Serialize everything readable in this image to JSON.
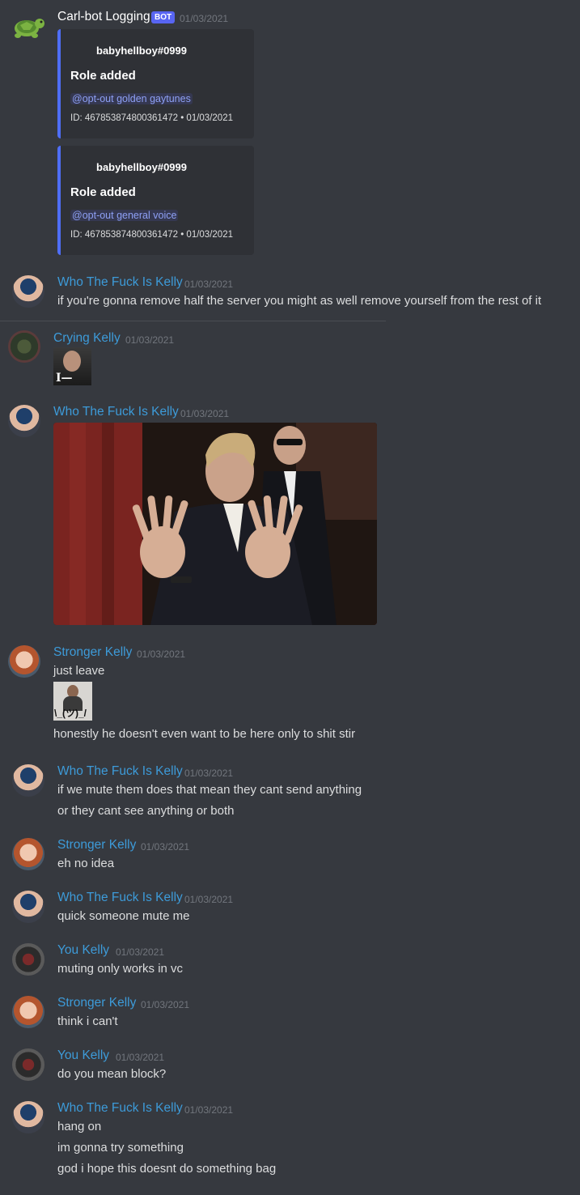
{
  "messages": [
    {
      "author": "Carl-bot Logging",
      "author_color": "#ffffff",
      "is_bot": true,
      "bot_tag": "BOT",
      "timestamp": "01/03/2021",
      "avatar": "turtle-icon",
      "embeds": [
        {
          "author": "babyhellboy#0999",
          "title": "Role added",
          "mention": "@opt-out golden gaytunes",
          "footer": "ID: 467853874800361472 • 01/03/2021"
        },
        {
          "author": "babyhellboy#0999",
          "title": "Role added",
          "mention": "@opt-out general voice",
          "footer": "ID: 467853874800361472 • 01/03/2021"
        }
      ]
    },
    {
      "author": "Who The Fuck Is Kelly",
      "author_color": "#3d9bd9",
      "timestamp": "01/03/2021",
      "avatar": "user-avatar",
      "lines": [
        "if you're gonna remove half the server you might as well remove yourself from the rest of it"
      ]
    },
    {
      "author": "Crying Kelly",
      "author_color": "#3d9bd9",
      "timestamp": "01/03/2021",
      "avatar": "user-avatar",
      "sticker_text": "I—"
    },
    {
      "author": "Who The Fuck Is Kelly",
      "author_color": "#3d9bd9",
      "timestamp": "01/03/2021",
      "avatar": "user-avatar",
      "attachment": "gif-image"
    },
    {
      "author": "Stronger Kelly",
      "author_color": "#3d9bd9",
      "timestamp": "01/03/2021",
      "avatar": "user-avatar",
      "lines": [
        "just leave",
        "honestly he doesn't even want to be here only to shit stir"
      ],
      "sticker_text": "\\_(ツ)_/"
    },
    {
      "author": "Who The Fuck Is Kelly",
      "author_color": "#3d9bd9",
      "timestamp": "01/03/2021",
      "avatar": "user-avatar",
      "lines": [
        "if we mute them does that mean they cant send anything",
        "or they cant see anything or both"
      ]
    },
    {
      "author": "Stronger Kelly",
      "author_color": "#3d9bd9",
      "timestamp": "01/03/2021",
      "avatar": "user-avatar",
      "lines": [
        "eh no idea"
      ]
    },
    {
      "author": "Who The Fuck Is Kelly",
      "author_color": "#3d9bd9",
      "timestamp": "01/03/2021",
      "avatar": "user-avatar",
      "lines": [
        "quick someone mute me"
      ]
    },
    {
      "author": "You Kelly",
      "author_color": "#3d9bd9",
      "timestamp": "01/03/2021",
      "avatar": "user-avatar",
      "lines": [
        "muting only works in vc"
      ]
    },
    {
      "author": "Stronger Kelly",
      "author_color": "#3d9bd9",
      "timestamp": "01/03/2021",
      "avatar": "user-avatar",
      "lines": [
        "think i can't"
      ]
    },
    {
      "author": "You Kelly",
      "author_color": "#3d9bd9",
      "timestamp": "01/03/2021",
      "avatar": "user-avatar",
      "lines": [
        "do you mean block?"
      ]
    },
    {
      "author": "Who The Fuck Is Kelly",
      "author_color": "#3d9bd9",
      "timestamp": "01/03/2021",
      "avatar": "user-avatar",
      "lines": [
        "hang on",
        "im gonna try something",
        "god i hope this doesnt do something bag"
      ]
    }
  ]
}
